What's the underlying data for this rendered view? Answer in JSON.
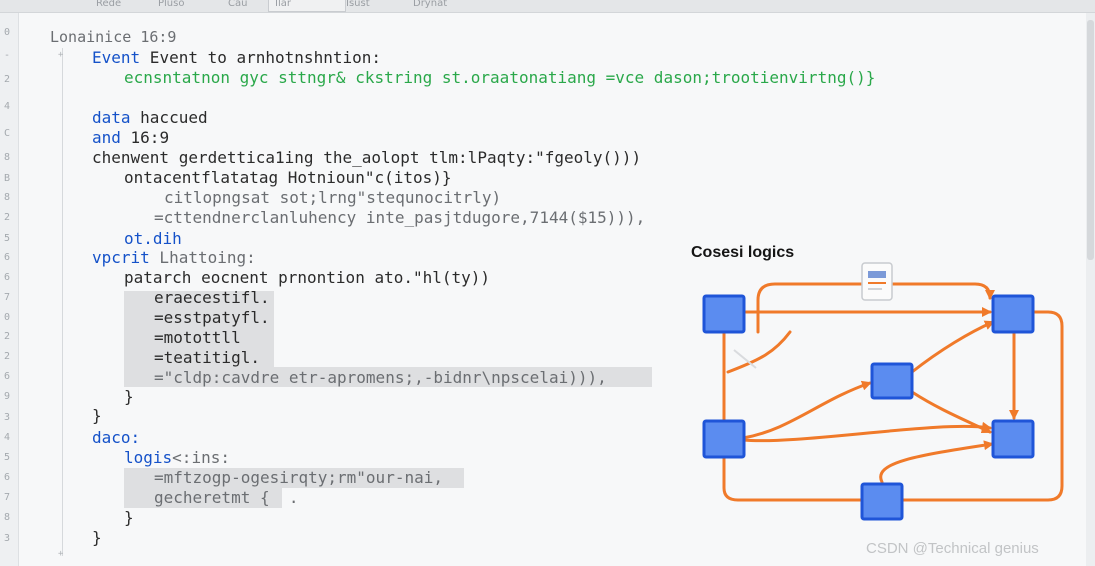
{
  "tabs": [
    "Rede",
    "Pluso",
    "Cau",
    "Ilar",
    "Isust",
    "Drynat"
  ],
  "line_numbers": [
    "0",
    "-",
    "2",
    "4",
    "C",
    "8",
    "B",
    "8",
    "2",
    "5",
    "6",
    "6",
    "7",
    "0",
    "2",
    "2",
    "6",
    "9",
    "3",
    "4",
    "5",
    "6",
    "7",
    "8",
    "3"
  ],
  "code": {
    "l1_a": "Lonainice",
    "l1_b": "16:9",
    "l2_kw": "Event",
    "l2_rest": " Event to arnhotnshntion:",
    "l3": "ecnsntatnon gyc sttngr& ckstring st.oraatonatiang =vce dason;trootienvirtng()}",
    "l5_kw": "data",
    "l5_rest": " haccued",
    "l6_kw": "and",
    "l6_rest": " 16:9",
    "l7": "chenwent gerdettica1ing the_aolopt tlm:lPaqty:\"fgeoly()))",
    "l8": "ontacentflatatag Hotnioun\"c(itos)}",
    "l9": "citlopngsat sot;lrng\"stequnocitrly)",
    "l10": "=cttendnerclanluhency inte_pasjtdugore,7144($15))),",
    "l11_kw": "ot.dih",
    "l12_kw": "vpcrit",
    "l12_rest": " Lhattoing:",
    "l13": "patarch eocnent prnontion ato.\"hl(ty))",
    "l14": "eraecestifl.",
    "l15": "=esstpatyfl.",
    "l16": "=motottll",
    "l17": "=teatitigl.",
    "l18": "=\"cldp:cavdre etr-apromens;,-bidnr\\npscelai))),",
    "l19": "}",
    "l20": "}",
    "l21_kw": "daco:",
    "l22_kw": "logis",
    "l22_rest": "<:ins:",
    "l23": "=mftzogp-ogesirqty;rm\"our-nai,",
    "l24": "gecheretmt {  .",
    "l25": "}",
    "l26": "}"
  },
  "diagram": {
    "title": "Cosesi logics",
    "node_color": "#5b8cf0",
    "node_border": "#1f55d8",
    "edge_color": "#f07a2a"
  },
  "watermark": "CSDN @Technical genius"
}
